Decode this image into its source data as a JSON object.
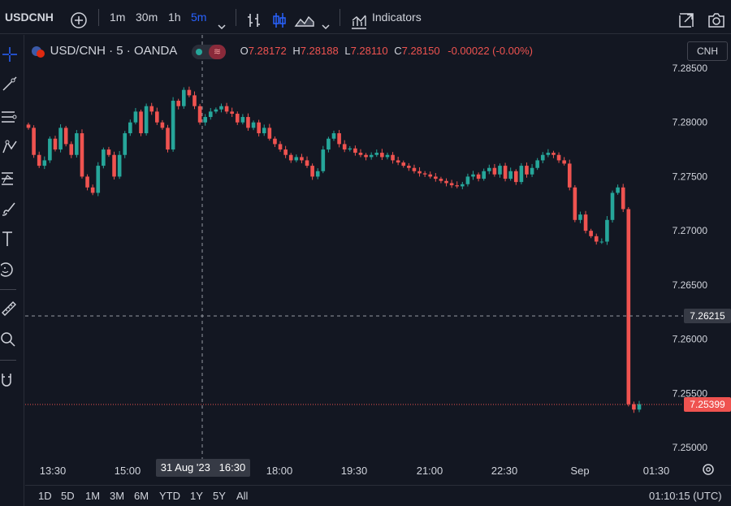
{
  "toolbar": {
    "symbol": "USDCNH",
    "intervals": [
      "1m",
      "30m",
      "1h",
      "5m"
    ],
    "active_interval": "5m",
    "indicators_label": "Indicators"
  },
  "legend": {
    "title": "USD/CNH · 5 · OANDA",
    "o_label": "O",
    "o_value": "7.28172",
    "h_label": "H",
    "h_value": "7.28188",
    "l_label": "L",
    "l_value": "7.28110",
    "c_label": "C",
    "c_value": "7.28150",
    "change": "-0.00022 (-0.00%)"
  },
  "currency_button": "CNH",
  "price_labels": {
    "crosshair": "7.26215",
    "last": "7.25399"
  },
  "time_labels": {
    "crosshair": "31 Aug '23   16:30"
  },
  "bottom": {
    "ranges": [
      "1D",
      "5D",
      "1M",
      "3M",
      "6M",
      "YTD",
      "1Y",
      "5Y",
      "All"
    ],
    "clock": "01:10:15 (UTC)"
  },
  "colors": {
    "up": "#26a69a",
    "down": "#ef5350",
    "accent": "#2962ff",
    "background": "#131722"
  },
  "chart_data": {
    "type": "candlestick",
    "y_axis_ticks": [
      "7.28500",
      "7.28000",
      "7.27500",
      "7.27000",
      "7.26500",
      "7.26000",
      "7.25500",
      "7.25000"
    ],
    "x_axis_ticks": [
      "13:30",
      "15:00",
      "18:00",
      "19:30",
      "21:00",
      "22:30",
      "Sep",
      "01:30"
    ],
    "ylim": [
      7.25,
      7.285
    ],
    "closes": [
      7.2795,
      7.277,
      7.276,
      7.2765,
      7.2785,
      7.2775,
      7.2795,
      7.278,
      7.277,
      7.279,
      7.275,
      7.274,
      7.2735,
      7.276,
      7.2775,
      7.277,
      7.275,
      7.277,
      7.279,
      7.28,
      7.281,
      7.279,
      7.2815,
      7.281,
      7.28,
      7.2795,
      7.2775,
      7.282,
      7.2815,
      7.283,
      7.2825,
      7.2815,
      7.28,
      7.2805,
      7.281,
      7.2812,
      7.2815,
      7.281,
      7.2808,
      7.28,
      7.2805,
      7.2795,
      7.28,
      7.279,
      7.2795,
      7.2785,
      7.278,
      7.2775,
      7.277,
      7.2765,
      7.2768,
      7.2765,
      7.276,
      7.275,
      7.2755,
      7.2775,
      7.2785,
      7.279,
      7.278,
      7.2775,
      7.2776,
      7.2772,
      7.277,
      7.2768,
      7.277,
      7.2772,
      7.2768,
      7.277,
      7.2765,
      7.2763,
      7.276,
      7.2758,
      7.2755,
      7.2753,
      7.2752,
      7.275,
      7.2748,
      7.2746,
      7.2744,
      7.2742,
      7.2741,
      7.2743,
      7.275,
      7.2752,
      7.2748,
      7.2755,
      7.2758,
      7.2752,
      7.276,
      7.2748,
      7.2755,
      7.2745,
      7.276,
      7.2752,
      7.2758,
      7.2765,
      7.277,
      7.2772,
      7.277,
      7.2765,
      7.2762,
      7.274,
      7.271,
      7.2715,
      7.27,
      7.2695,
      7.269,
      7.269,
      7.271,
      7.2735,
      7.274,
      7.272,
      7.254,
      7.2535,
      7.254
    ]
  }
}
